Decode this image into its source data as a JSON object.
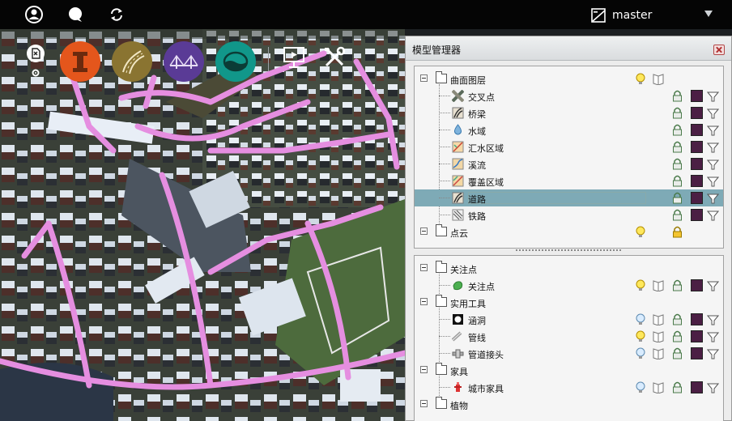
{
  "topbar": {
    "branch_label": "master",
    "icons": [
      "user-circle-icon",
      "chat-bubble-icon",
      "sync-icon",
      "branch-icon",
      "chevron-down-icon"
    ]
  },
  "toolbar": {
    "tools": [
      {
        "name": "model-tool",
        "color": "#e4561c",
        "icon": "model-icon"
      },
      {
        "name": "road-tool",
        "color": "#8a7431",
        "icon": "road-icon"
      },
      {
        "name": "bridge-tool",
        "color": "#5a3b96",
        "icon": "bridge-icon"
      },
      {
        "name": "water-tool",
        "color": "#11978a",
        "icon": "water-icon"
      }
    ],
    "extra_icons": [
      "settings-icon",
      "presentation-icon",
      "tools-icon"
    ]
  },
  "panel": {
    "title": "模型管理器",
    "top_tree": [
      {
        "label": "曲面图层",
        "level": 0,
        "icon": "folder-icon",
        "bulb": true,
        "book": true
      },
      {
        "label": "交叉点",
        "level": 1,
        "icon": "intersection-icon",
        "lock": true
      },
      {
        "label": "桥梁",
        "level": 1,
        "icon": "bridge-layer-icon",
        "lock": true
      },
      {
        "label": "水域",
        "level": 1,
        "icon": "water-drop-icon",
        "lock": true
      },
      {
        "label": "汇水区域",
        "level": 1,
        "icon": "catchment-icon",
        "lock": true
      },
      {
        "label": "溪流",
        "level": 1,
        "icon": "stream-icon",
        "lock": true
      },
      {
        "label": "覆盖区域",
        "level": 1,
        "icon": "coverage-icon",
        "lock": true
      },
      {
        "label": "道路",
        "level": 1,
        "icon": "road-layer-icon",
        "lock": true,
        "selected": true
      },
      {
        "label": "铁路",
        "level": 1,
        "icon": "railway-icon",
        "lock": true
      },
      {
        "label": "点云",
        "level": 0,
        "icon": "folder-icon",
        "bulb": true,
        "lock": true,
        "lock_yellow": true
      }
    ],
    "bottom_tree": [
      {
        "label": "关注点",
        "level": 0,
        "icon": "folder-icon"
      },
      {
        "label": "关注点",
        "level": 1,
        "icon": "poi-icon",
        "bulb": true,
        "book": true,
        "lock": true
      },
      {
        "label": "实用工具",
        "level": 0,
        "icon": "folder-icon"
      },
      {
        "label": "涵洞",
        "level": 1,
        "icon": "culvert-icon",
        "bulb": true,
        "bulb_blue": true,
        "book": true,
        "lock": true
      },
      {
        "label": "管线",
        "level": 1,
        "icon": "pipe-icon",
        "bulb": true,
        "book": true,
        "lock": true
      },
      {
        "label": "管道接头",
        "level": 1,
        "icon": "pipe-joint-icon",
        "bulb": true,
        "bulb_blue": true,
        "book": true,
        "lock": true
      },
      {
        "label": "家具",
        "level": 0,
        "icon": "folder-icon"
      },
      {
        "label": "城市家具",
        "level": 1,
        "icon": "hydrant-icon",
        "bulb": true,
        "bulb_blue": true,
        "book": true,
        "lock": true
      },
      {
        "label": "植物",
        "level": 0,
        "icon": "folder-icon"
      }
    ],
    "colors": {
      "swatch": "#4b1f44",
      "selection": "#7eaab6"
    }
  }
}
